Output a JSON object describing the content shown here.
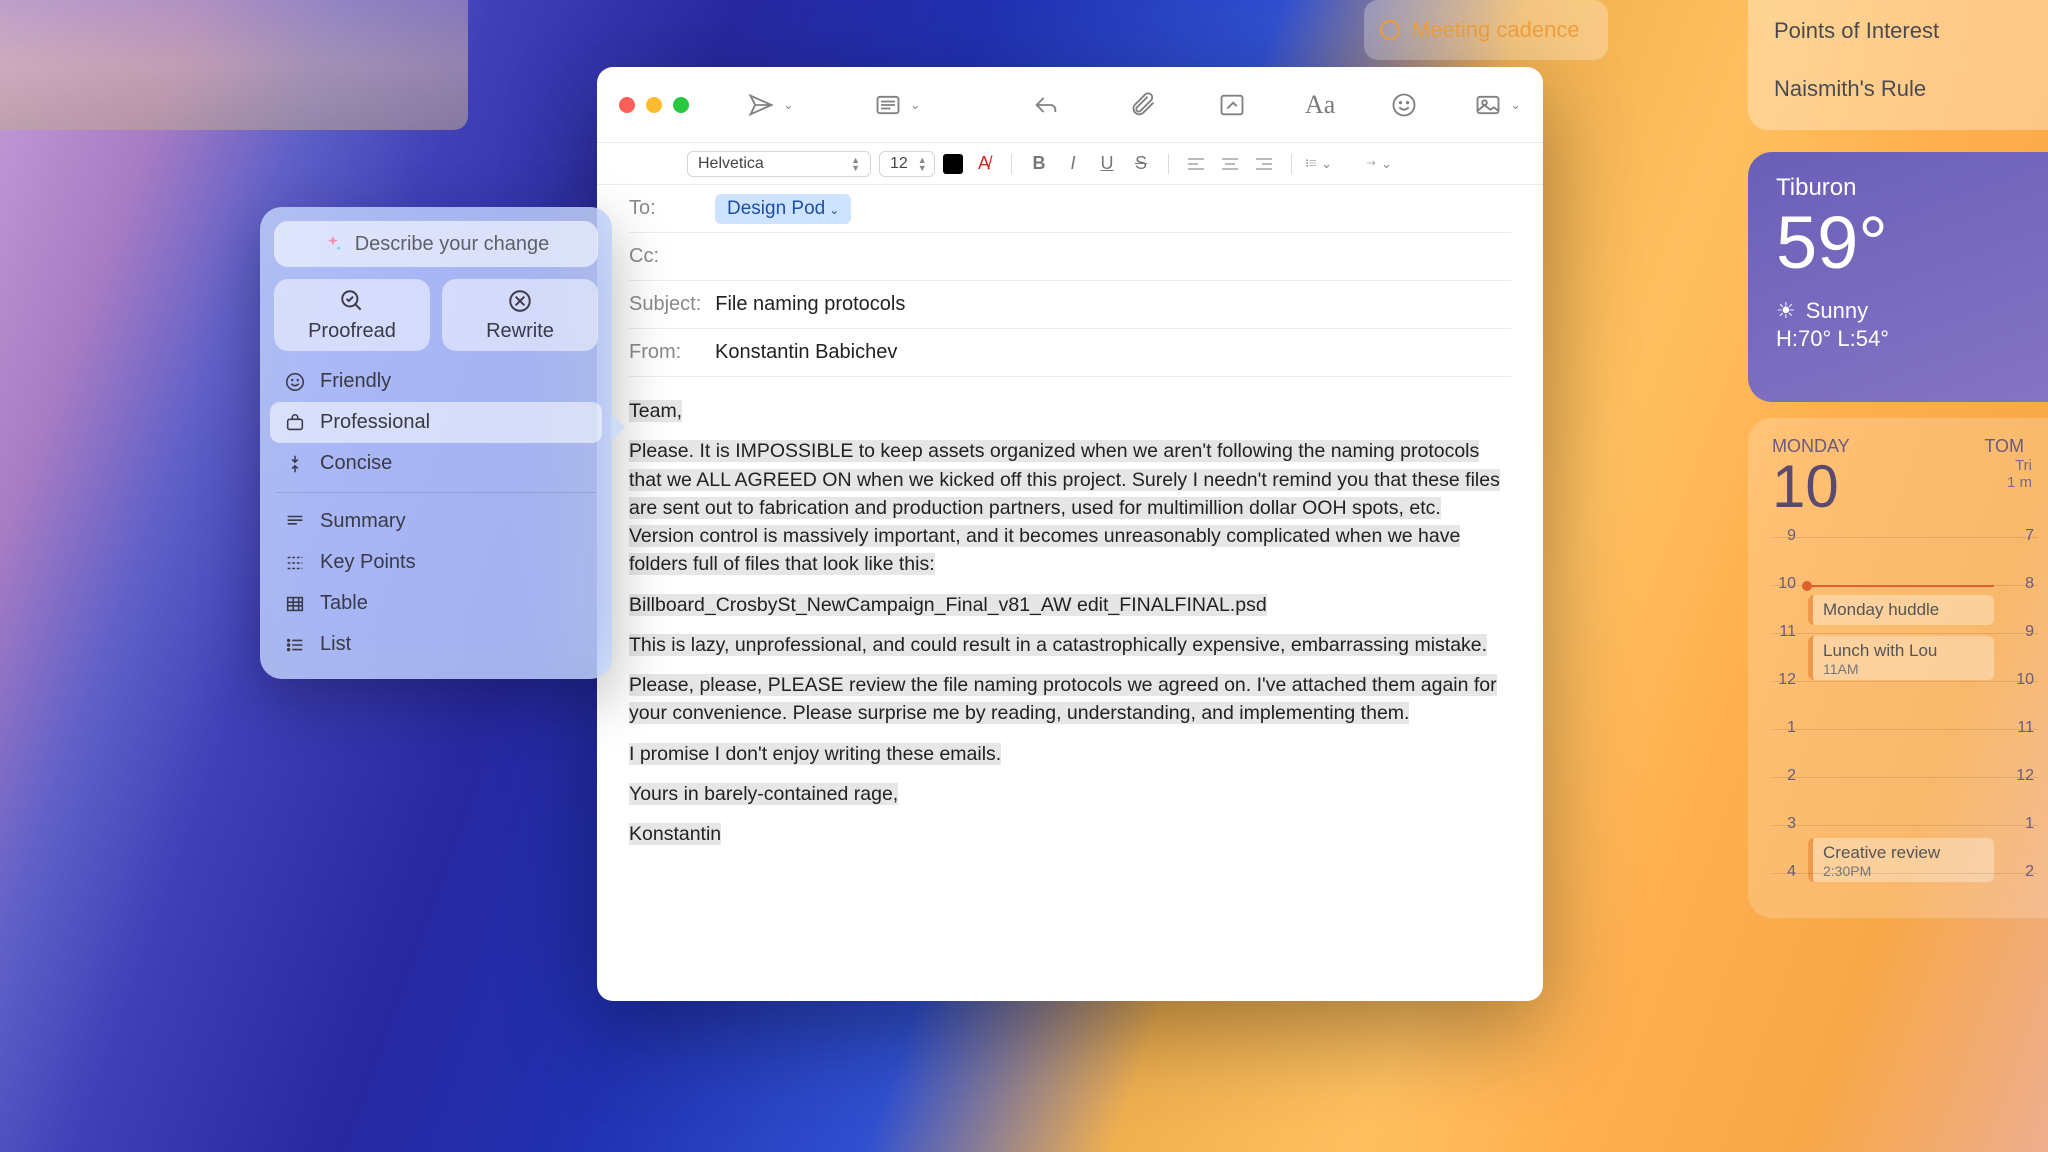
{
  "reminders": {
    "meeting": "Meeting cadence",
    "items": [
      "Points of Interest",
      "Naismith's Rule"
    ]
  },
  "weather": {
    "location": "Tiburon",
    "temp": "59°",
    "condition": "Sunny",
    "hilo": "H:70° L:54°"
  },
  "calendar": {
    "weekday": "MONDAY",
    "tomorrow": "TOM",
    "day": "10",
    "hours_left": [
      "9",
      "10",
      "11",
      "12",
      "1",
      "2",
      "3",
      "4"
    ],
    "hours_right": [
      "7",
      "8",
      "9",
      "10",
      "11",
      "12",
      "1",
      "2"
    ],
    "extra_right_first": "1 m",
    "events": {
      "huddle": {
        "title": "Monday huddle",
        "time": ""
      },
      "lunch": {
        "title": "Lunch with Lou",
        "time": "11AM"
      },
      "review": {
        "title": "Creative review",
        "time": "2:30PM"
      }
    },
    "trip_hint": "Tri"
  },
  "compose": {
    "font": "Helvetica",
    "size": "12",
    "to_label": "To:",
    "to_value": "Design Pod",
    "cc_label": "Cc:",
    "subject_label": "Subject:",
    "subject": "File naming protocols",
    "from_label": "From:",
    "from": "Konstantin Babichev",
    "body": {
      "p1": "Team,",
      "p2": "Please. It is IMPOSSIBLE to keep assets organized when we aren't following the naming protocols that we ALL AGREED ON when we kicked off this project. Surely I needn't remind you that these files are sent out to fabrication and production partners, used for multimillion dollar OOH spots, etc. Version control is massively important, and it becomes unreasonably complicated when we have folders full of files that look like this:",
      "p3": "Billboard_CrosbySt_NewCampaign_Final_v81_AW edit_FINALFINAL.psd",
      "p4": "This is lazy, unprofessional, and could result in a catastrophically expensive, embarrassing mistake.",
      "p5": "Please, please, PLEASE review the file naming protocols we agreed on. I've attached them again for your convenience. Please surprise me by reading, understanding, and implementing them.",
      "p6": "I promise I don't enjoy writing these emails.",
      "p7": "Yours in barely-contained rage,",
      "p8": "Konstantin"
    }
  },
  "popover": {
    "prompt": "Describe your change",
    "proofread": "Proofread",
    "rewrite": "Rewrite",
    "tones": {
      "friendly": "Friendly",
      "professional": "Professional",
      "concise": "Concise"
    },
    "formats": {
      "summary": "Summary",
      "keypoints": "Key Points",
      "table": "Table",
      "list": "List"
    }
  },
  "fmt": {
    "b": "B",
    "i": "I",
    "u": "U",
    "s": "S"
  }
}
